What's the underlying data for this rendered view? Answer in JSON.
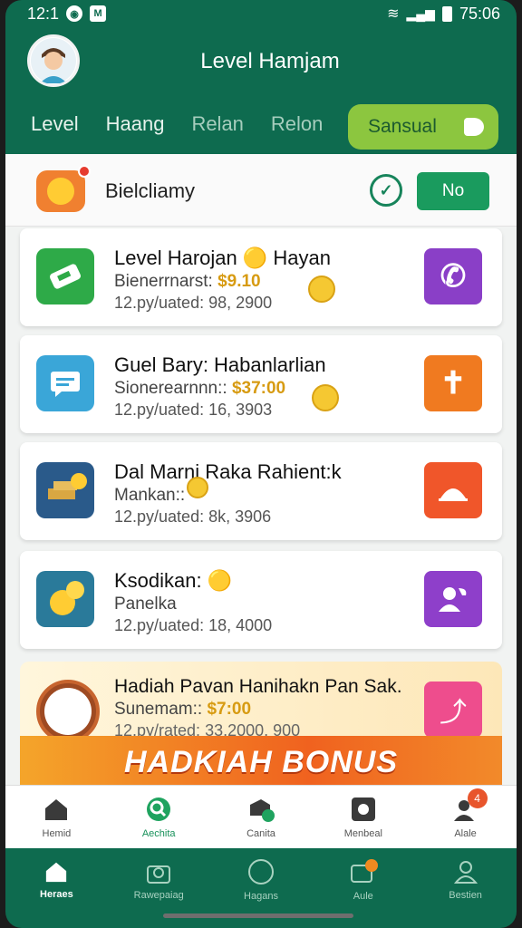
{
  "status": {
    "time_left": "12:1",
    "time_right": "75:06"
  },
  "header": {
    "title": "Level Hamjam"
  },
  "tabs": [
    {
      "label": "Level"
    },
    {
      "label": "Haang"
    },
    {
      "label": "Relan"
    },
    {
      "label": "Relon"
    }
  ],
  "cta": {
    "label": "Sansual",
    "color": "#8cc63f"
  },
  "subheader": {
    "title": "Bielcliamy",
    "button": "No"
  },
  "cards": [
    {
      "title": "Level Harojan 🟡 Hayan",
      "line2_label": "Bienerrnarst:",
      "line2_amount": "$9.10",
      "line3": "12.py/uated: 98, 2900",
      "left_icon": "ticket-icon",
      "right_icon": "phone-icon"
    },
    {
      "title": "Guel Bary: Habanlarlian",
      "line2_label": "Sionerearnnn::",
      "line2_amount": "$37:00",
      "line3": "12.py/uated: 16, 3903",
      "left_icon": "chat-icon",
      "right_icon": "cross-icon"
    },
    {
      "title": "Dal Marni Raka Rahient:k",
      "line2_label": "Mankan::",
      "line2_amount": "",
      "line3": "12.py/uated: 8k, 3906",
      "left_icon": "gold-bars-icon",
      "right_icon": "sunrise-icon"
    },
    {
      "title": "Ksodikan: 🟡",
      "line2_label": "Panelka",
      "line2_amount": "",
      "line3": "12.py/uated: 18, 4000",
      "left_icon": "emoji-icon",
      "right_icon": "user-chat-icon"
    }
  ],
  "bonus": {
    "title": "Hadiah Pavan Hanihakn Pan Sak.",
    "line2_label": "Sunemam::",
    "line2_amount": "$7:00",
    "line3": "12.py/rated: 33.2000, 900",
    "banner": "HADKIAH BONUS"
  },
  "bottom_nav": [
    {
      "label": "Hemid",
      "icon": "home-icon"
    },
    {
      "label": "Aechita",
      "icon": "search-icon"
    },
    {
      "label": "Canita",
      "icon": "badge-check-icon"
    },
    {
      "label": "Menbeal",
      "icon": "camera-icon"
    },
    {
      "label": "Alale",
      "icon": "user-alert-icon",
      "badge": "4"
    }
  ],
  "tab_bar": [
    {
      "label": "Heraes",
      "icon": "home-icon"
    },
    {
      "label": "Rawepaiag",
      "icon": "gift-icon"
    },
    {
      "label": "Hagans",
      "icon": "circle-icon"
    },
    {
      "label": "Aule",
      "icon": "ticket-alert-icon"
    },
    {
      "label": "Bestien",
      "icon": "profile-icon"
    }
  ]
}
